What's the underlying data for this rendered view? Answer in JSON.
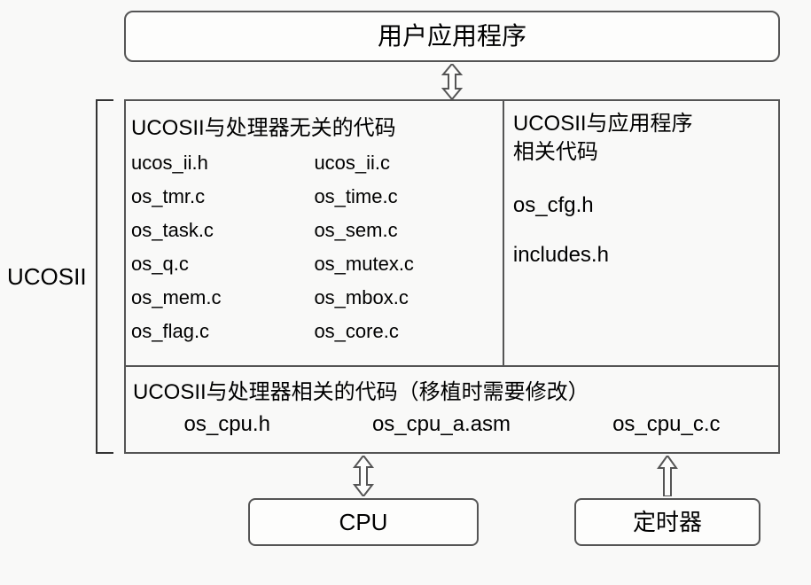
{
  "top": {
    "title": "用户应用程序"
  },
  "bracket": {
    "label": "UCOSII"
  },
  "proc_indep": {
    "title": "UCOSII与处理器无关的代码",
    "files": [
      "ucos_ii.h",
      "ucos_ii.c",
      "os_tmr.c",
      "os_time.c",
      "os_task.c",
      "os_sem.c",
      "os_q.c",
      "os_mutex.c",
      "os_mem.c",
      "os_mbox.c",
      "os_flag.c",
      "os_core.c"
    ]
  },
  "app_related": {
    "title_line1": "UCOSII与应用程序",
    "title_line2": "相关代码",
    "files": [
      "os_cfg.h",
      "includes.h"
    ]
  },
  "port": {
    "title": "UCOSII与处理器相关的代码（移植时需要修改）",
    "files": [
      "os_cpu.h",
      "os_cpu_a.asm",
      "os_cpu_c.c"
    ]
  },
  "cpu": {
    "label": "CPU"
  },
  "timer": {
    "label": "定时器"
  }
}
